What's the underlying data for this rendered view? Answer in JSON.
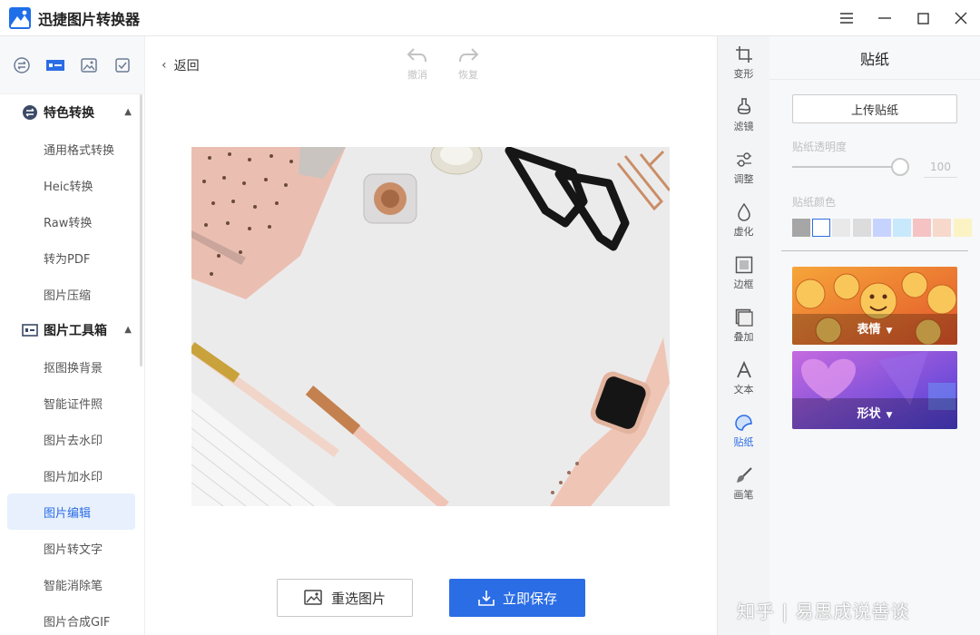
{
  "app": {
    "title": "迅捷图片转换器"
  },
  "sidebar": {
    "groups": [
      {
        "label": "特色转换",
        "items": [
          "通用格式转换",
          "Heic转换",
          "Raw转换",
          "转为PDF",
          "图片压缩"
        ]
      },
      {
        "label": "图片工具箱",
        "items": [
          "抠图换背景",
          "智能证件照",
          "图片去水印",
          "图片加水印",
          "图片编辑",
          "图片转文字",
          "智能消除笔",
          "图片合成GIF"
        ]
      }
    ],
    "active_item": "图片编辑"
  },
  "editor": {
    "back_label": "返回",
    "undo_label": "撤消",
    "redo_label": "恢复",
    "reselect_label": "重选图片",
    "save_label": "立即保存"
  },
  "tools": [
    {
      "label": "变形",
      "icon": "crop-icon"
    },
    {
      "label": "滤镜",
      "icon": "filter-icon"
    },
    {
      "label": "调整",
      "icon": "adjust-icon"
    },
    {
      "label": "虚化",
      "icon": "blur-icon"
    },
    {
      "label": "边框",
      "icon": "border-icon"
    },
    {
      "label": "叠加",
      "icon": "overlay-icon"
    },
    {
      "label": "文本",
      "icon": "text-icon"
    },
    {
      "label": "贴纸",
      "icon": "sticker-icon"
    },
    {
      "label": "画笔",
      "icon": "brush-icon"
    }
  ],
  "active_tool": "贴纸",
  "panel": {
    "title": "贴纸",
    "upload_label": "上传贴纸",
    "opacity_label": "贴纸透明度",
    "opacity_value": "100",
    "color_label": "贴纸颜色",
    "swatches": [
      "#a6a6a6",
      "#ffffff",
      "#e9e9e9",
      "#dcdcdc",
      "#c7d3ff",
      "#c8e9fb",
      "#f5c3c3",
      "#f6d9cb",
      "#fbf3c4"
    ],
    "categories": [
      {
        "label": "表情"
      },
      {
        "label": "形状"
      }
    ]
  },
  "watermark": "知乎 | 易思成说善谈",
  "colors": {
    "accent": "#2b6de5",
    "active_bg": "#e8f0fd"
  }
}
